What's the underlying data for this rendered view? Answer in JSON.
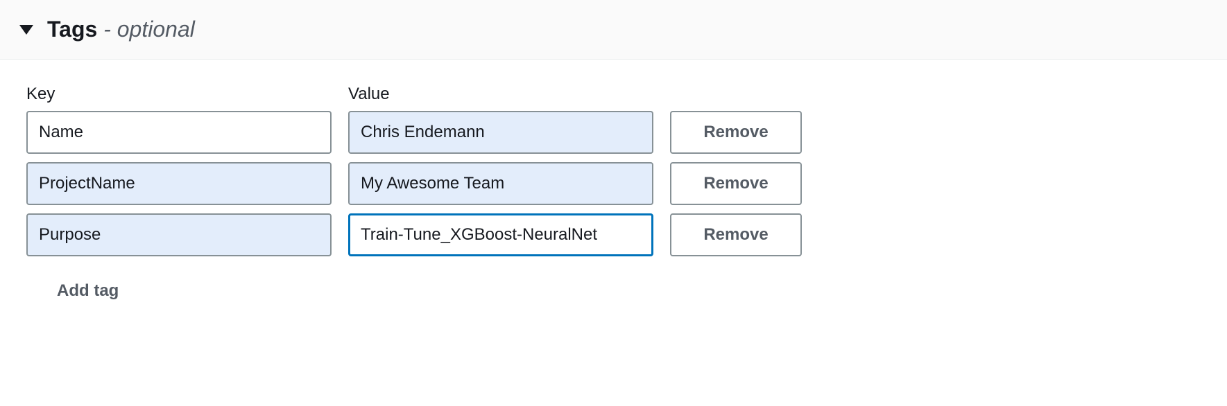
{
  "section": {
    "title": "Tags",
    "optional_label": " - optional"
  },
  "columns": {
    "key": "Key",
    "value": "Value"
  },
  "rows": [
    {
      "key": "Name",
      "value": "Chris Endemann",
      "key_filled": false,
      "value_filled": true,
      "value_focused": false
    },
    {
      "key": "ProjectName",
      "value": "My Awesome Team",
      "key_filled": true,
      "value_filled": true,
      "value_focused": false
    },
    {
      "key": "Purpose",
      "value": "Train-Tune_XGBoost-NeuralNet",
      "key_filled": true,
      "value_filled": false,
      "value_focused": true
    }
  ],
  "buttons": {
    "remove": "Remove",
    "add_tag": "Add tag"
  }
}
